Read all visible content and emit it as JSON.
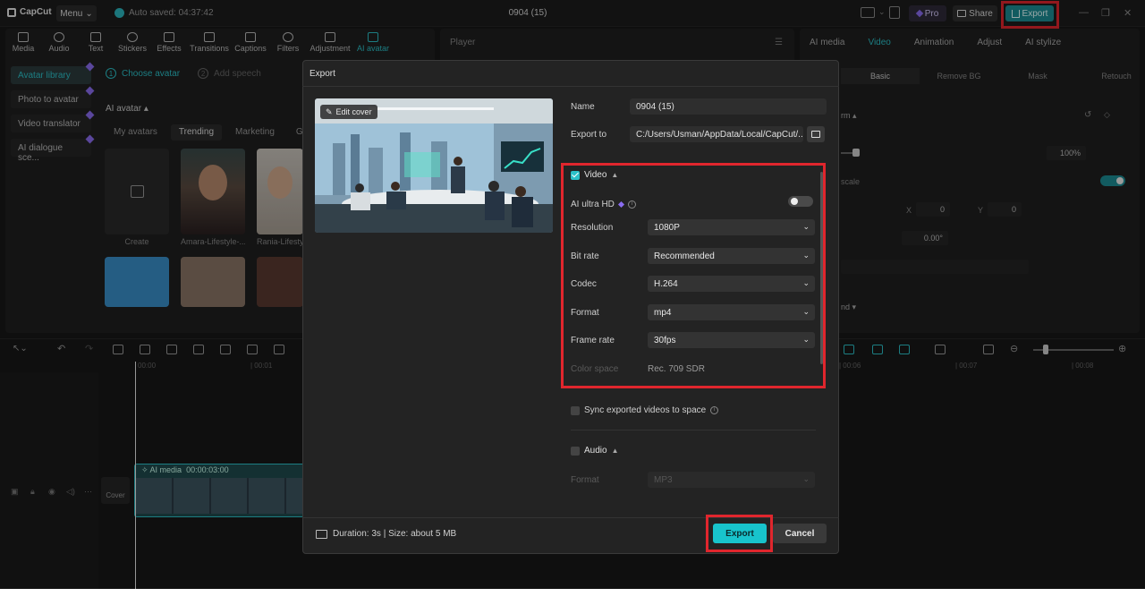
{
  "topbar": {
    "app_name": "CapCut",
    "menu_label": "Menu",
    "autosave_text": "Auto saved: 04:37:42",
    "project_title": "0904 (15)",
    "pro_label": "Pro",
    "share_label": "Share",
    "export_label": "Export"
  },
  "toolbar": {
    "tools": [
      {
        "label": "Media"
      },
      {
        "label": "Audio"
      },
      {
        "label": "Text"
      },
      {
        "label": "Stickers"
      },
      {
        "label": "Effects"
      },
      {
        "label": "Transitions"
      },
      {
        "label": "Captions"
      },
      {
        "label": "Filters"
      },
      {
        "label": "Adjustment"
      },
      {
        "label": "AI avatar"
      }
    ]
  },
  "sidebar": {
    "items": [
      {
        "label": "Avatar library"
      },
      {
        "label": "Photo to avatar"
      },
      {
        "label": "Video translator"
      },
      {
        "label": "AI dialogue sce..."
      }
    ]
  },
  "avatar_panel": {
    "step1": {
      "num": "1",
      "label": "Choose avatar"
    },
    "step2": {
      "num": "2",
      "label": "Add speech"
    },
    "section_label": "AI avatar",
    "chips": [
      {
        "label": "My avatars"
      },
      {
        "label": "Trending"
      },
      {
        "label": "Marketing"
      },
      {
        "label": "G"
      }
    ],
    "cards": [
      {
        "label": "Create"
      },
      {
        "label": "Amara-Lifestyle-..."
      },
      {
        "label": "Rania-Lifesty"
      }
    ]
  },
  "player": {
    "title": "Player"
  },
  "right_panel": {
    "tabs": [
      {
        "label": "AI media"
      },
      {
        "label": "Video"
      },
      {
        "label": "Animation"
      },
      {
        "label": "Adjust"
      },
      {
        "label": "AI stylize"
      }
    ],
    "subtabs": [
      {
        "label": "Basic"
      },
      {
        "label": "Remove BG"
      },
      {
        "label": "Mask"
      },
      {
        "label": "Retouch"
      }
    ],
    "transform_label": "rm",
    "scale_value": "100%",
    "uniform_scale_label": "scale",
    "x_label": "X",
    "x_value": "0",
    "y_label": "Y",
    "y_value": "0",
    "rotate_value": "0.00°",
    "blend_label": "nd"
  },
  "timeline": {
    "ruler": [
      "00:00",
      "| 00:01",
      "| 00:06",
      "| 00:07",
      "| 00:08"
    ],
    "clip_label": "AI media",
    "clip_time": "00:00:03:00",
    "cover_label": "Cover"
  },
  "export_dialog": {
    "title": "Export",
    "edit_cover_label": "Edit cover",
    "name_label": "Name",
    "name_value": "0904 (15)",
    "export_to_label": "Export to",
    "export_to_value": "C:/Users/Usman/AppData/Local/CapCut/...",
    "video_section": "Video",
    "ai_ultra_hd_label": "AI ultra HD",
    "resolution_label": "Resolution",
    "resolution_value": "1080P",
    "bitrate_label": "Bit rate",
    "bitrate_value": "Recommended",
    "codec_label": "Codec",
    "codec_value": "H.264",
    "format_label": "Format",
    "format_value": "mp4",
    "framerate_label": "Frame rate",
    "framerate_value": "30fps",
    "colorspace_label": "Color space",
    "colorspace_value": "Rec. 709 SDR",
    "sync_label": "Sync exported videos to space",
    "audio_section": "Audio",
    "audio_format_label": "Format",
    "audio_format_value": "MP3",
    "footer_info": "Duration: 3s | Size: about 5 MB",
    "export_button": "Export",
    "cancel_button": "Cancel"
  },
  "colors": {
    "accent": "#18c4cc",
    "highlight_box": "#e0262d",
    "background": "#181818",
    "dialog": "#232323"
  }
}
